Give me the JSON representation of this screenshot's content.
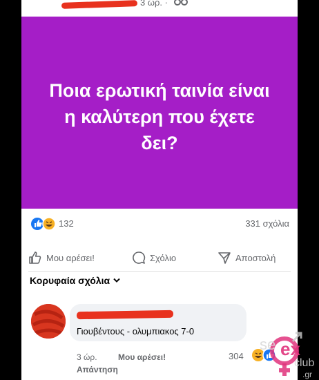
{
  "post": {
    "time": "3 ώρ. ·",
    "banner_text": "Ποια ερωτική ταινία είναι η καλύτερη που έχετε δει?",
    "reaction_count": "132",
    "comment_count": "331 σχόλια"
  },
  "actions": {
    "like": "Μου αρέσει!",
    "comment": "Σχόλιο",
    "share": "Αποστολή"
  },
  "comments_sort": "Κορυφαία σχόλια",
  "comment": {
    "text": "Γιουβέντους - ολυμπιακος 7-0",
    "time": "3 ώρ.",
    "like": "Μου αρέσει!",
    "reply": "Απάντηση",
    "reaction_count": "304"
  },
  "colors": {
    "banner": "#a51ec7",
    "redaction": "#e8321e",
    "like_blue": "#1877f2",
    "haha_yellow": "#f7b125"
  },
  "watermark": {
    "text": "sex club .gr"
  }
}
